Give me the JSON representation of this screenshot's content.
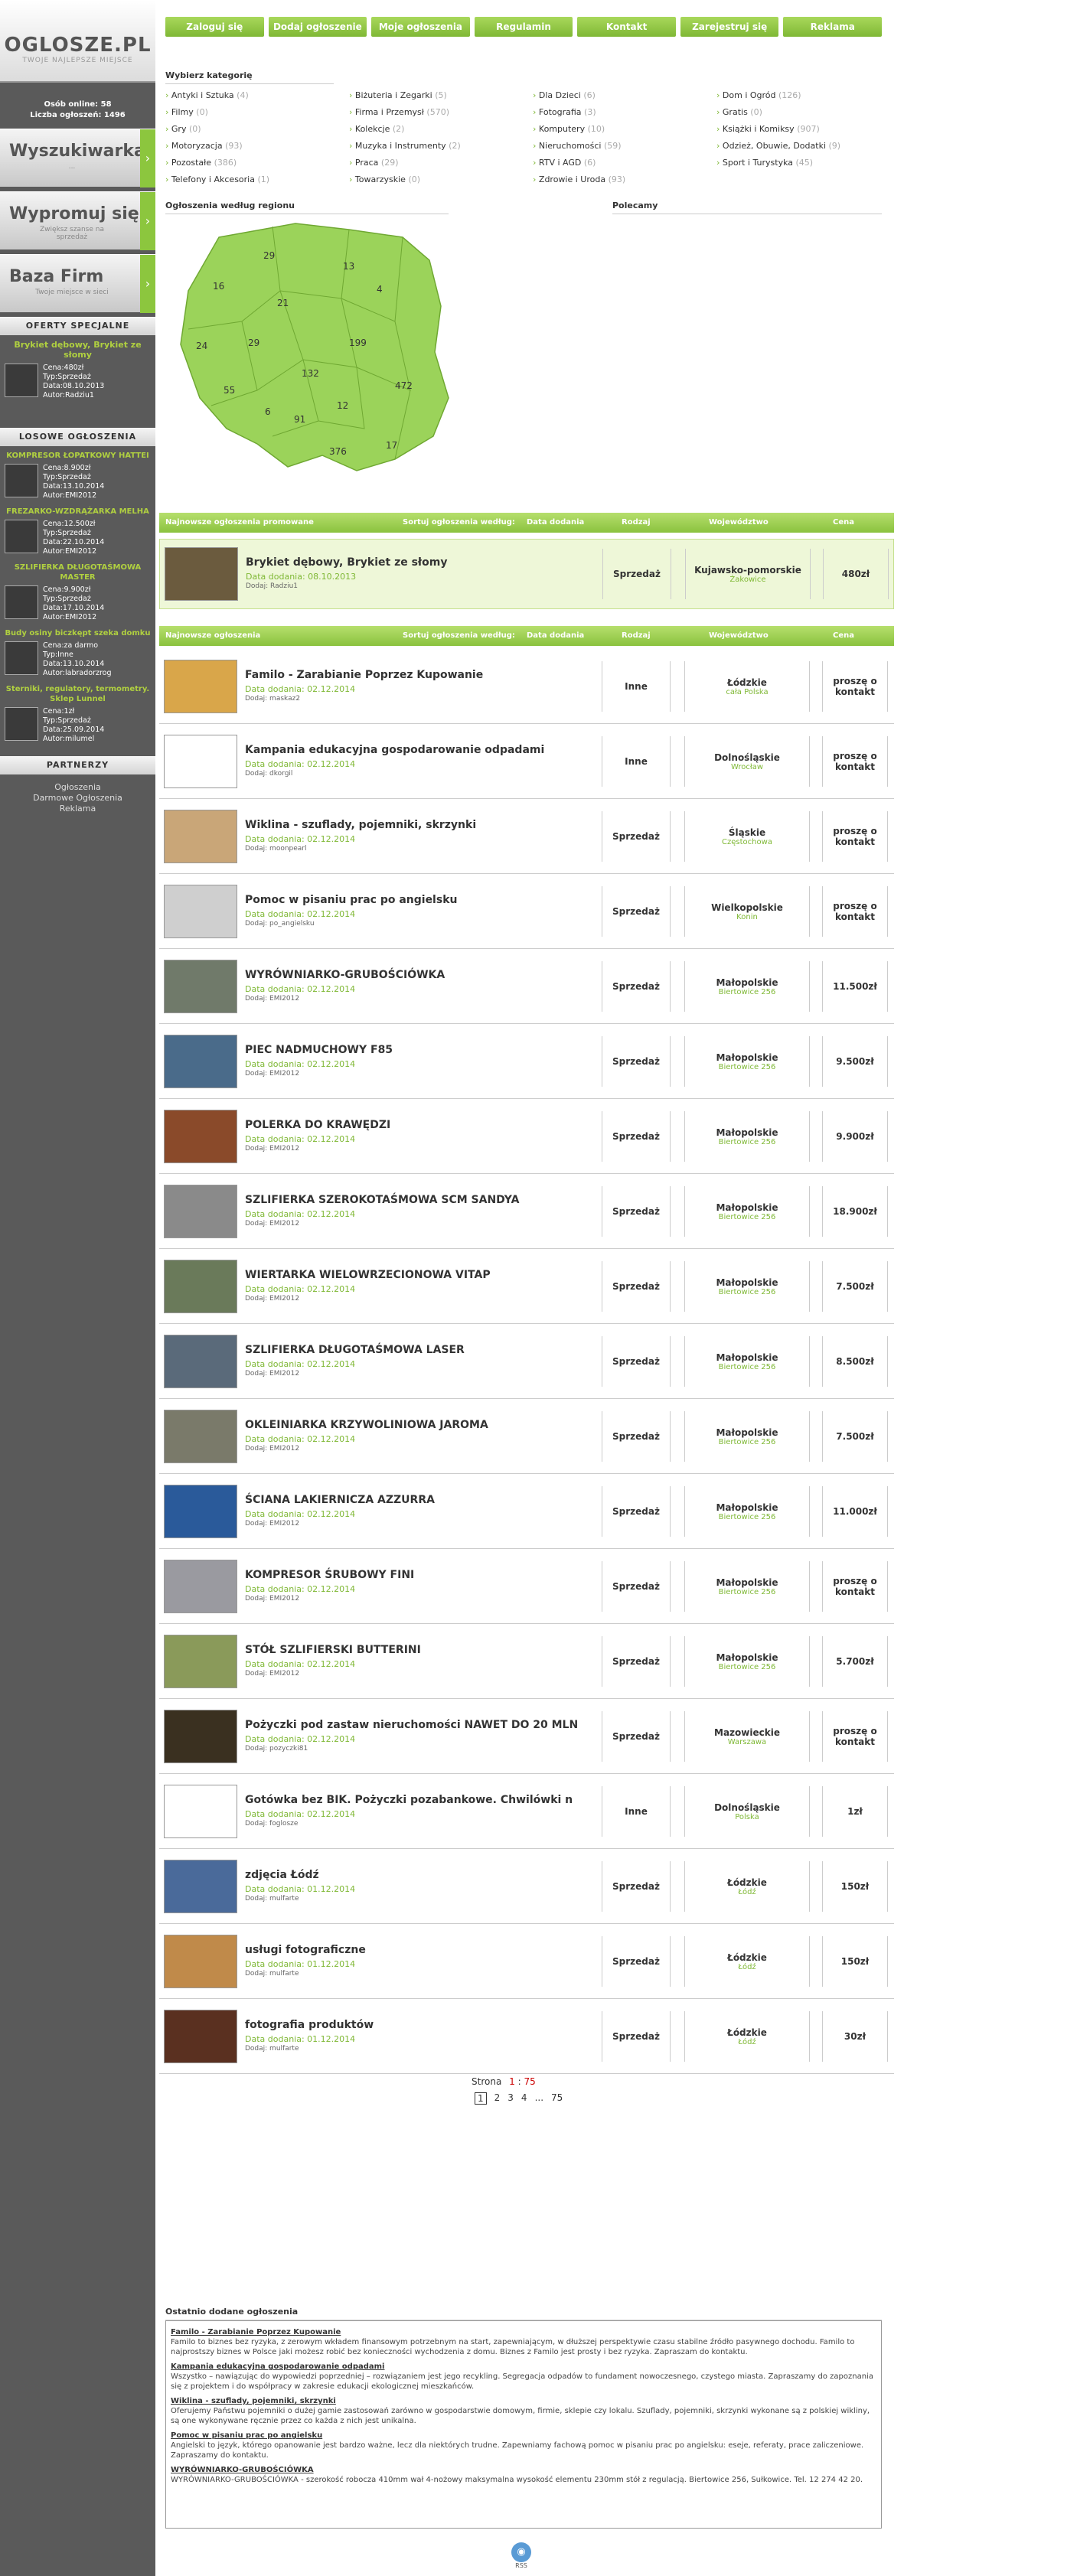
{
  "logo": {
    "title": "OGLOSZE.PL",
    "subtitle": "TWOJE NAJLEPSZE MIEJSCE"
  },
  "online": {
    "line1": "Osób online: 58",
    "line2": "Liczba ogłoszeń: 1496"
  },
  "side_buttons": [
    {
      "title": "Wyszukiwarka",
      "sub": "..."
    },
    {
      "title": "Wypromuj się!",
      "sub": "Zwiększ szanse na sprzedaż"
    },
    {
      "title": "Baza Firm",
      "sub": "Twoje miejsce w sieci"
    }
  ],
  "special": {
    "header": "OFERTY SPECJALNE",
    "title": "Brykiet dębowy, Brykiet ze słomy",
    "lines": [
      "Cena:480zł",
      "Typ:Sprzedaż",
      "Data:08.10.2013",
      "Autor:Radziu1"
    ]
  },
  "random": {
    "header": "LOSOWE OGŁOSZENIA",
    "items": [
      {
        "title": "KOMPRESOR ŁOPATKOWY HATTEI",
        "lines": [
          "Cena:8.900zł",
          "Typ:Sprzedaż",
          "Data:13.10.2014",
          "Autor:EMI2012"
        ]
      },
      {
        "title": "FREZARKO-WZDRĄŻARKA MELHA",
        "lines": [
          "Cena:12.500zł",
          "Typ:Sprzedaż",
          "Data:22.10.2014",
          "Autor:EMI2012"
        ]
      },
      {
        "title": "SZLIFIERKA DŁUGOTAŚMOWA MASTER",
        "lines": [
          "Cena:9.900zł",
          "Typ:Sprzedaż",
          "Data:17.10.2014",
          "Autor:EMI2012"
        ]
      },
      {
        "title": "Budy osiny biczkępt szeka domku",
        "lines": [
          "Cena:za darmo",
          "Typ:Inne",
          "Data:13.10.2014",
          "Autor:labradorzrog"
        ]
      },
      {
        "title": "Sterniki, regulatory, termometry. Sklep Lunnel",
        "lines": [
          "Cena:1zł",
          "Typ:Sprzedaż",
          "Data:25.09.2014",
          "Autor:milumel"
        ]
      }
    ]
  },
  "partners": {
    "header": "PARTNERZY",
    "links": [
      "Ogłoszenia",
      "Darmowe Ogłoszenia",
      "Reklama"
    ]
  },
  "nav": [
    "Zaloguj się",
    "Dodaj ogłoszenie",
    "Moje ogłoszenia",
    "Regulamin",
    "Kontakt",
    "Zarejestruj się",
    "Reklama"
  ],
  "categories_title": "Wybierz kategorię",
  "categories": [
    [
      "Antyki i Sztuka",
      "(4)"
    ],
    [
      "Biżuteria i Zegarki",
      "(5)"
    ],
    [
      "Dla Dzieci",
      "(6)"
    ],
    [
      "Dom i Ogród",
      "(126)"
    ],
    [
      "Filmy",
      "(0)"
    ],
    [
      "Firma i Przemysł",
      "(570)"
    ],
    [
      "Fotografia",
      "(3)"
    ],
    [
      "Gratis",
      "(0)"
    ],
    [
      "Gry",
      "(0)"
    ],
    [
      "Kolekcje",
      "(2)"
    ],
    [
      "Komputery",
      "(10)"
    ],
    [
      "Książki i Komiksy",
      "(907)"
    ],
    [
      "Motoryzacja",
      "(93)"
    ],
    [
      "Muzyka i Instrumenty",
      "(2)"
    ],
    [
      "Nieruchomości",
      "(59)"
    ],
    [
      "Odzież, Obuwie, Dodatki",
      "(9)"
    ],
    [
      "Pozostałe",
      "(386)"
    ],
    [
      "Praca",
      "(29)"
    ],
    [
      "RTV i AGD",
      "(6)"
    ],
    [
      "Sport i Turystyka",
      "(45)"
    ],
    [
      "Telefony i Akcesoria",
      "(1)"
    ],
    [
      "Towarzyskie",
      "(0)"
    ],
    [
      "Zdrowie i Uroda",
      "(93)"
    ]
  ],
  "regions_title": "Ogłoszenia według regionu",
  "featured_title": "Polecamy",
  "map_counts": [
    "29",
    "13",
    "16",
    "21",
    "4",
    "24",
    "29",
    "199",
    "132",
    "55",
    "12",
    "472",
    "6",
    "91",
    "376",
    "17"
  ],
  "table_headers": {
    "promo": "Najnowsze ogłoszenia promowane",
    "newest": "Najnowsze ogłoszenia",
    "sort": "Sortuj ogłoszenia według:",
    "date": "Data dodania",
    "type": "Rodzaj",
    "region": "Województwo",
    "price": "Cena"
  },
  "promo_row": {
    "title": "Brykiet dębowy, Brykiet ze słomy",
    "date": "Data dodania: 08.10.2013",
    "author": "Dodaj: Radziu1",
    "type": "Sprzedaż",
    "region": "Kujawsko-pomorskie",
    "city": "Żakowice",
    "price": "480zł"
  },
  "rows": [
    {
      "title": "Familo - Zarabianie Poprzez Kupowanie",
      "date": "Data dodania: 02.12.2014",
      "author": "Dodaj: maskaz2",
      "type": "Inne",
      "region": "Łódzkie",
      "city": "cała Polska",
      "price": "proszę o kontakt"
    },
    {
      "title": "Kampania edukacyjna gospodarowanie odpadami",
      "date": "Data dodania: 02.12.2014",
      "author": "Dodaj: dkorgil",
      "type": "Inne",
      "region": "Dolnośląskie",
      "city": "Wrocław",
      "price": "proszę o kontakt"
    },
    {
      "title": "Wiklina - szuflady, pojemniki, skrzynki",
      "date": "Data dodania: 02.12.2014",
      "author": "Dodaj: moonpearl",
      "type": "Sprzedaż",
      "region": "Śląskie",
      "city": "Częstochowa",
      "price": "proszę o kontakt"
    },
    {
      "title": "Pomoc w pisaniu prac po angielsku",
      "date": "Data dodania: 02.12.2014",
      "author": "Dodaj: po_angielsku",
      "type": "Sprzedaż",
      "region": "Wielkopolskie",
      "city": "Konin",
      "price": "proszę o kontakt"
    },
    {
      "title": "WYRÓWNIARKO-GRUBOŚCIÓWKA",
      "date": "Data dodania: 02.12.2014",
      "author": "Dodaj: EMI2012",
      "type": "Sprzedaż",
      "region": "Małopolskie",
      "city": "Biertowice 256",
      "price": "11.500zł"
    },
    {
      "title": "PIEC NADMUCHOWY F85",
      "date": "Data dodania: 02.12.2014",
      "author": "Dodaj: EMI2012",
      "type": "Sprzedaż",
      "region": "Małopolskie",
      "city": "Biertowice 256",
      "price": "9.500zł"
    },
    {
      "title": "POLERKA DO KRAWĘDZI",
      "date": "Data dodania: 02.12.2014",
      "author": "Dodaj: EMI2012",
      "type": "Sprzedaż",
      "region": "Małopolskie",
      "city": "Biertowice 256",
      "price": "9.900zł"
    },
    {
      "title": "SZLIFIERKA SZEROKOTAŚMOWA SCM SANDYA",
      "date": "Data dodania: 02.12.2014",
      "author": "Dodaj: EMI2012",
      "type": "Sprzedaż",
      "region": "Małopolskie",
      "city": "Biertowice 256",
      "price": "18.900zł"
    },
    {
      "title": "WIERTARKA WIELOWRZECIONOWA VITAP",
      "date": "Data dodania: 02.12.2014",
      "author": "Dodaj: EMI2012",
      "type": "Sprzedaż",
      "region": "Małopolskie",
      "city": "Biertowice 256",
      "price": "7.500zł"
    },
    {
      "title": "SZLIFIERKA DŁUGOTAŚMOWA LASER",
      "date": "Data dodania: 02.12.2014",
      "author": "Dodaj: EMI2012",
      "type": "Sprzedaż",
      "region": "Małopolskie",
      "city": "Biertowice 256",
      "price": "8.500zł"
    },
    {
      "title": "OKLEINIARKA KRZYWOLINIOWA JAROMA",
      "date": "Data dodania: 02.12.2014",
      "author": "Dodaj: EMI2012",
      "type": "Sprzedaż",
      "region": "Małopolskie",
      "city": "Biertowice 256",
      "price": "7.500zł"
    },
    {
      "title": "ŚCIANA LAKIERNICZA AZZURRA",
      "date": "Data dodania: 02.12.2014",
      "author": "Dodaj: EMI2012",
      "type": "Sprzedaż",
      "region": "Małopolskie",
      "city": "Biertowice 256",
      "price": "11.000zł"
    },
    {
      "title": "KOMPRESOR ŚRUBOWY FINI",
      "date": "Data dodania: 02.12.2014",
      "author": "Dodaj: EMI2012",
      "type": "Sprzedaż",
      "region": "Małopolskie",
      "city": "Biertowice 256",
      "price": "proszę o kontakt"
    },
    {
      "title": "STÓŁ SZLIFIERSKI BUTTERINI",
      "date": "Data dodania: 02.12.2014",
      "author": "Dodaj: EMI2012",
      "type": "Sprzedaż",
      "region": "Małopolskie",
      "city": "Biertowice 256",
      "price": "5.700zł"
    },
    {
      "title": "Pożyczki pod zastaw nieruchomości NAWET DO 20 MLN",
      "date": "Data dodania: 02.12.2014",
      "author": "Dodaj: pozyczki81",
      "type": "Sprzedaż",
      "region": "Mazowieckie",
      "city": "Warszawa",
      "price": "proszę o kontakt"
    },
    {
      "title": "Gotówka bez BIK. Pożyczki pozabankowe. Chwilówki n",
      "date": "Data dodania: 02.12.2014",
      "author": "Dodaj: foglosze",
      "type": "Inne",
      "region": "Dolnośląskie",
      "city": "Polska",
      "price": "1zł"
    },
    {
      "title": "zdjęcia Łódź",
      "date": "Data dodania: 01.12.2014",
      "author": "Dodaj: mulfarte",
      "type": "Sprzedaż",
      "region": "Łódzkie",
      "city": "Łódź",
      "price": "150zł"
    },
    {
      "title": "usługi fotograficzne",
      "date": "Data dodania: 01.12.2014",
      "author": "Dodaj: mulfarte",
      "type": "Sprzedaż",
      "region": "Łódzkie",
      "city": "Łódź",
      "price": "150zł"
    },
    {
      "title": "fotografia produktów",
      "date": "Data dodania: 01.12.2014",
      "author": "Dodaj: mulfarte",
      "type": "Sprzedaż",
      "region": "Łódzkie",
      "city": "Łódź",
      "price": "30zł"
    }
  ],
  "pagination": {
    "label": "Strona",
    "current": "1",
    "sep": ":",
    "total": "75",
    "pages": [
      "1",
      "2",
      "3",
      "4",
      "...",
      "75"
    ]
  },
  "recent": {
    "title": "Ostatnio dodane ogłoszenia",
    "items": [
      {
        "title": "Familo - Zarabianie Poprzez Kupowanie",
        "text": "Familo to biznes bez ryzyka, z zerowym wkładem finansowym potrzebnym na start, zapewniającym, w dłuższej perspektywie czasu stabilne źródło pasywnego dochodu. Familo to najprostszy biznes w Polsce jaki możesz robić bez konieczności wychodzenia z domu. Biznes z Familo jest prosty i bez ryzyka. Zapraszam do kontaktu."
      },
      {
        "title": "Kampania edukacyjna gospodarowanie odpadami",
        "text": "Wszystko – nawiązując do wypowiedzi poprzedniej – rozwiązaniem jest jego recykling. Segregacja odpadów to fundament nowoczesnego, czystego miasta. Zapraszamy do zapoznania się z projektem i do współpracy w zakresie edukacji ekologicznej mieszkańców."
      },
      {
        "title": "Wiklina - szuflady, pojemniki, skrzynki",
        "text": "Oferujemy Państwu pojemniki o dużej gamie zastosowań zarówno w gospodarstwie domowym, firmie, sklepie czy lokalu. Szuflady, pojemniki, skrzynki wykonane są z polskiej wikliny, są one wykonywane ręcznie przez co każda z nich jest unikalna."
      },
      {
        "title": "Pomoc w pisaniu prac po angielsku",
        "text": "Angielski to język, którego opanowanie jest bardzo ważne, lecz dla niektórych trudne. Zapewniamy fachową pomoc w pisaniu prac po angielsku: eseje, referaty, prace zaliczeniowe. Zapraszamy do kontaktu."
      },
      {
        "title": "WYRÓWNIARKO-GRUBOŚCIÓWKA",
        "text": "WYRÓWNIARKO-GRUBOŚCIÓWKA - szerokość robocza 410mm wał 4-nożowy maksymalna wysokość elementu 230mm stół z regulacją. Biertowice 256, Sułkowice. Tel. 12 274 42 20."
      }
    ]
  },
  "rss": "RSS"
}
